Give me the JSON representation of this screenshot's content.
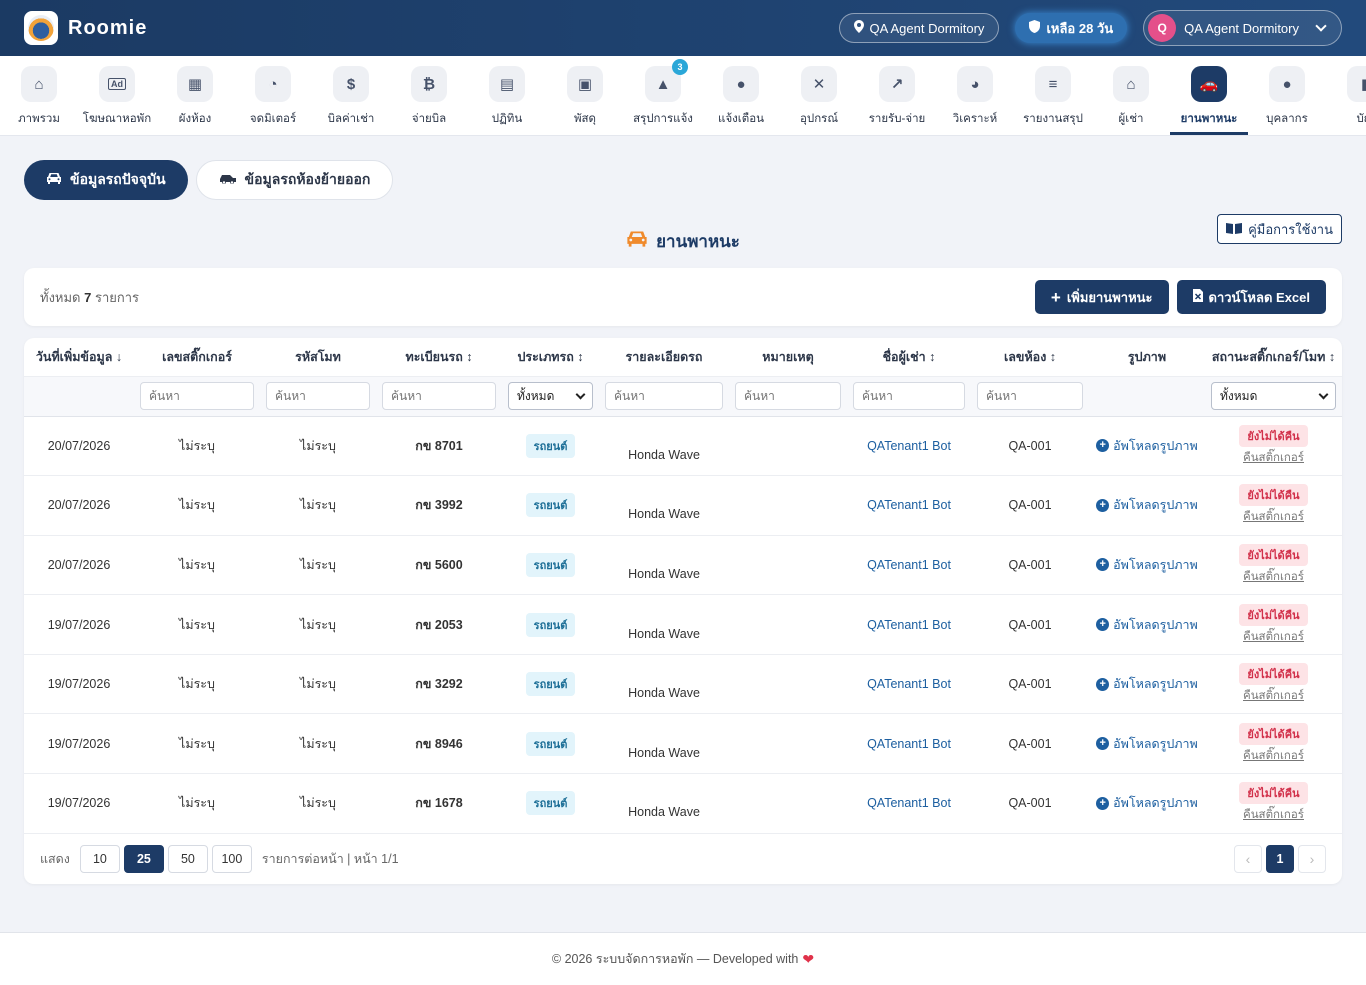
{
  "header": {
    "brand": "Roomie",
    "dorm_pill": "QA Agent Dormitory",
    "days_pill": "เหลือ 28 วัน",
    "user_initial": "Q",
    "user_name": "QA Agent Dormitory"
  },
  "nav": {
    "items": [
      {
        "label": "ภาพรวม",
        "icon": "home-icon",
        "glyph": "⌂"
      },
      {
        "label": "โฆษณาหอพัก",
        "icon": "ad-icon",
        "glyph": "Ad"
      },
      {
        "label": "ผังห้อง",
        "icon": "grid-icon",
        "glyph": "▦"
      },
      {
        "label": "จดมิเตอร์",
        "icon": "gauge-icon",
        "glyph": "◔"
      },
      {
        "label": "บิลค่าเช่า",
        "icon": "invoice-icon",
        "glyph": "$"
      },
      {
        "label": "จ่ายบิล",
        "icon": "money-icon",
        "glyph": "₿"
      },
      {
        "label": "ปฏิทิน",
        "icon": "calendar-icon",
        "glyph": "▤"
      },
      {
        "label": "พัสดุ",
        "icon": "boxes-icon",
        "glyph": "▣"
      },
      {
        "label": "สรุปการแจ้ง",
        "icon": "bell-icon",
        "glyph": "▲",
        "badge": "3"
      },
      {
        "label": "แจ้งเตือน",
        "icon": "chat-icon",
        "glyph": "●"
      },
      {
        "label": "อุปกรณ์",
        "icon": "tools-icon",
        "glyph": "✕"
      },
      {
        "label": "รายรับ-จ่าย",
        "icon": "chart-line-icon",
        "glyph": "↗"
      },
      {
        "label": "วิเคราะห์",
        "icon": "pie-chart-icon",
        "glyph": "◕"
      },
      {
        "label": "รายงานสรุป",
        "icon": "file-icon",
        "glyph": "≡"
      },
      {
        "label": "ผู้เช่า",
        "icon": "users-icon",
        "glyph": "⌂"
      },
      {
        "label": "ยานพาหนะ",
        "icon": "car-icon",
        "glyph": "🚗",
        "active": true
      },
      {
        "label": "บุคลากร",
        "icon": "user-icon",
        "glyph": "●"
      },
      {
        "label": "บัญ",
        "icon": "account-icon",
        "glyph": "▮"
      }
    ]
  },
  "tabs": {
    "current": "ข้อมูลรถปัจจุบัน",
    "moved_out": "ข้อมูลรถห้องย้ายออก"
  },
  "page": {
    "title": "ยานพาหนะ",
    "manual": "คู่มือการใช้งาน",
    "total_prefix": "ทั้งหมด",
    "total_count": "7",
    "total_suffix": "รายการ",
    "add_button": "เพิ่มยานพาหนะ",
    "excel_button": "ดาวน์โหลด Excel"
  },
  "table": {
    "headers": [
      "วันที่เพิ่มข้อมูล ↓",
      "เลขสติ๊กเกอร์",
      "รหัสโมท",
      "ทะเบียนรถ ↕",
      "ประเภทรถ ↕",
      "รายละเอียดรถ",
      "หมายเหตุ",
      "ชื่อผู้เช่า ↕",
      "เลขห้อง ↕",
      "รูปภาพ",
      "สถานะสติ๊กเกอร์/โมท ↕"
    ],
    "filter_placeholder": "ค้นหา",
    "filter_select_all": "ทั้งหมด",
    "rows": [
      {
        "date": "20/07/2026",
        "sticker": "ไม่ระบุ",
        "remote": "ไม่ระบุ",
        "plate": "กข 8701",
        "type": "รถยนต์",
        "detail": "Honda Wave",
        "note": "",
        "tenant": "QATenant1 Bot",
        "room": "QA-001",
        "image": "อัพโหลดรูปภาพ",
        "status": "ยังไม่ได้คืน",
        "return": "คืนสติ๊กเกอร์"
      },
      {
        "date": "20/07/2026",
        "sticker": "ไม่ระบุ",
        "remote": "ไม่ระบุ",
        "plate": "กข 3992",
        "type": "รถยนต์",
        "detail": "Honda Wave",
        "note": "",
        "tenant": "QATenant1 Bot",
        "room": "QA-001",
        "image": "อัพโหลดรูปภาพ",
        "status": "ยังไม่ได้คืน",
        "return": "คืนสติ๊กเกอร์"
      },
      {
        "date": "20/07/2026",
        "sticker": "ไม่ระบุ",
        "remote": "ไม่ระบุ",
        "plate": "กข 5600",
        "type": "รถยนต์",
        "detail": "Honda Wave",
        "note": "",
        "tenant": "QATenant1 Bot",
        "room": "QA-001",
        "image": "อัพโหลดรูปภาพ",
        "status": "ยังไม่ได้คืน",
        "return": "คืนสติ๊กเกอร์"
      },
      {
        "date": "19/07/2026",
        "sticker": "ไม่ระบุ",
        "remote": "ไม่ระบุ",
        "plate": "กข 2053",
        "type": "รถยนต์",
        "detail": "Honda Wave",
        "note": "",
        "tenant": "QATenant1 Bot",
        "room": "QA-001",
        "image": "อัพโหลดรูปภาพ",
        "status": "ยังไม่ได้คืน",
        "return": "คืนสติ๊กเกอร์"
      },
      {
        "date": "19/07/2026",
        "sticker": "ไม่ระบุ",
        "remote": "ไม่ระบุ",
        "plate": "กข 3292",
        "type": "รถยนต์",
        "detail": "Honda Wave",
        "note": "",
        "tenant": "QATenant1 Bot",
        "room": "QA-001",
        "image": "อัพโหลดรูปภาพ",
        "status": "ยังไม่ได้คืน",
        "return": "คืนสติ๊กเกอร์"
      },
      {
        "date": "19/07/2026",
        "sticker": "ไม่ระบุ",
        "remote": "ไม่ระบุ",
        "plate": "กข 8946",
        "type": "รถยนต์",
        "detail": "Honda Wave",
        "note": "",
        "tenant": "QATenant1 Bot",
        "room": "QA-001",
        "image": "อัพโหลดรูปภาพ",
        "status": "ยังไม่ได้คืน",
        "return": "คืนสติ๊กเกอร์"
      },
      {
        "date": "19/07/2026",
        "sticker": "ไม่ระบุ",
        "remote": "ไม่ระบุ",
        "plate": "กข 1678",
        "type": "รถยนต์",
        "detail": "Honda Wave",
        "note": "",
        "tenant": "QATenant1 Bot",
        "room": "QA-001",
        "image": "อัพโหลดรูปภาพ",
        "status": "ยังไม่ได้คืน",
        "return": "คืนสติ๊กเกอร์"
      }
    ]
  },
  "pager": {
    "show": "แสดง",
    "sizes": [
      "10",
      "25",
      "50",
      "100"
    ],
    "active_size": "25",
    "suffix": "รายการต่อหน้า | หน้า 1/1",
    "prev": "‹",
    "page": "1",
    "next": "›"
  },
  "footer": {
    "text": "© 2026 ระบบจัดการหอพัก — Developed with"
  },
  "colors": {
    "primary": "#1d3b66",
    "accent_car": "#f08a2c",
    "status_red": "#d2314b"
  }
}
